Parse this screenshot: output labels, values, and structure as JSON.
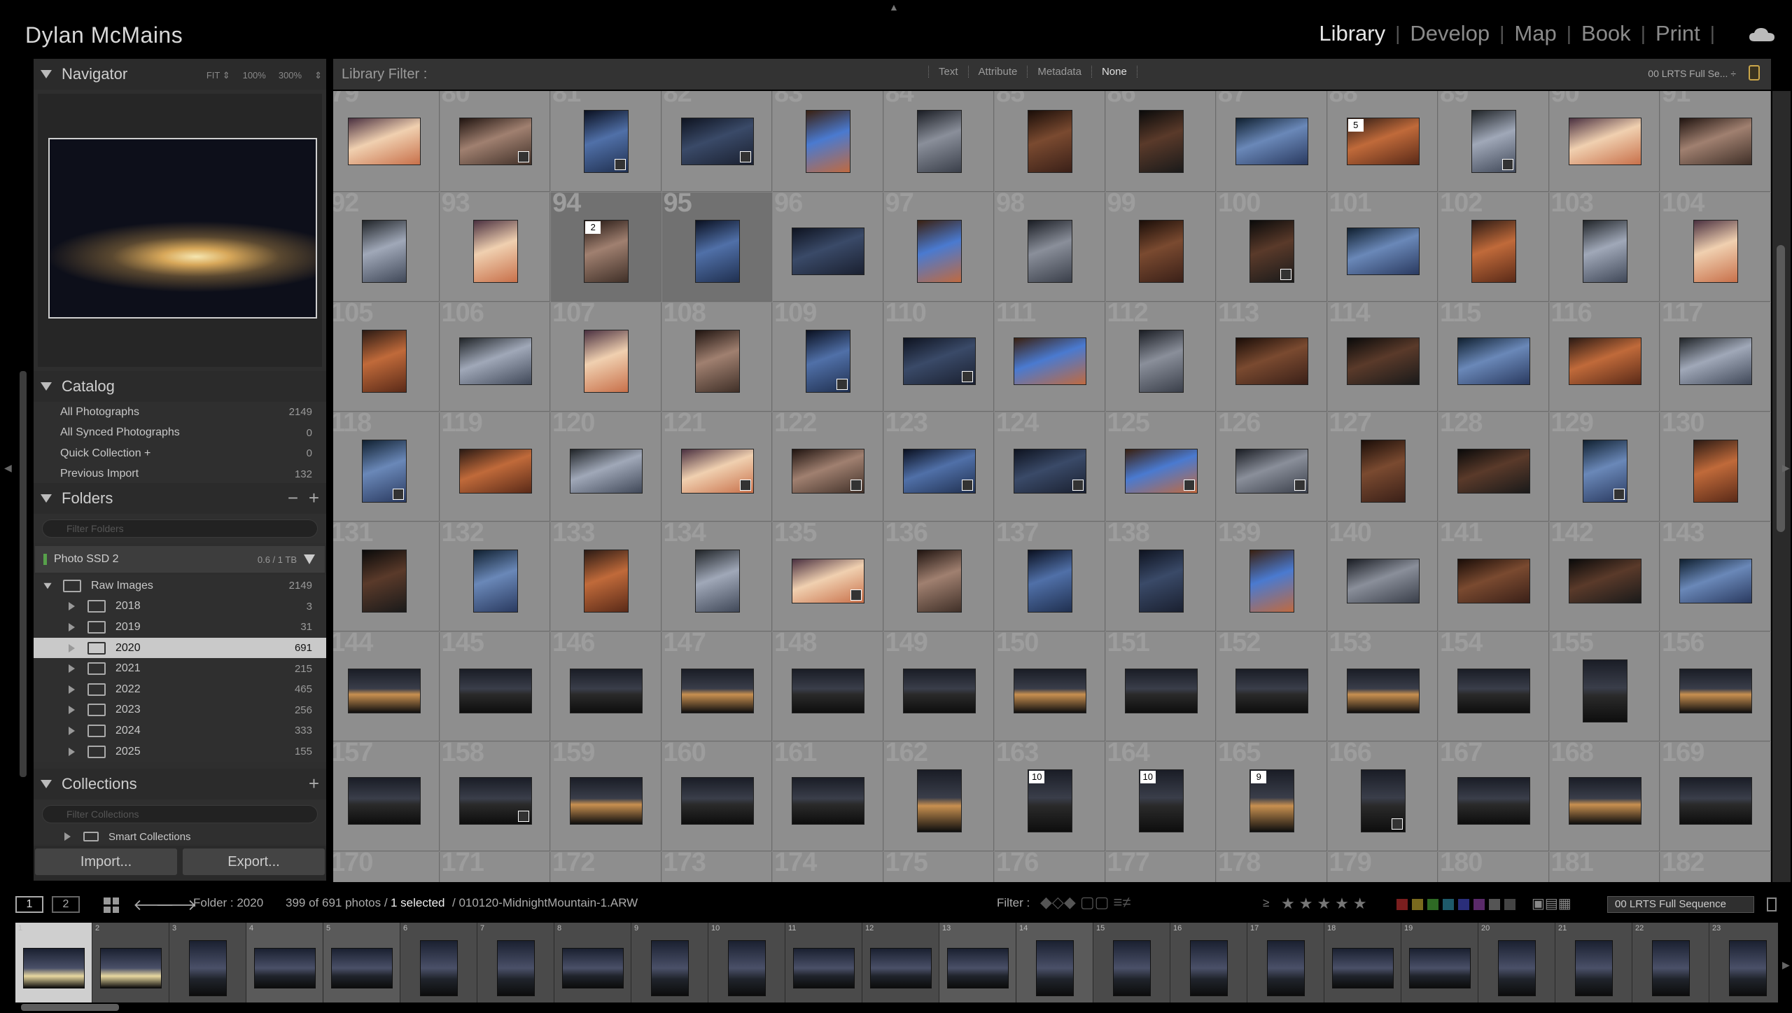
{
  "identity_plate": "Dylan McMains",
  "modules": [
    "Library",
    "Develop",
    "Map",
    "Book",
    "Print"
  ],
  "active_module": "Library",
  "navigator": {
    "title": "Navigator",
    "zoom": [
      "FIT ⇕",
      "100%",
      "300%",
      "⇕"
    ]
  },
  "catalog": {
    "title": "Catalog",
    "items": [
      {
        "label": "All Photographs",
        "count": "2149"
      },
      {
        "label": "All Synced Photographs",
        "count": "0"
      },
      {
        "label": "Quick Collection +",
        "count": "0"
      },
      {
        "label": "Previous Import",
        "count": "132"
      }
    ]
  },
  "folders": {
    "title": "Folders",
    "filter_placeholder": "Filter Folders",
    "volume": "Photo SSD 2",
    "volume_cap": "0.6 / 1 TB",
    "root": {
      "label": "Raw Images",
      "count": "2149"
    },
    "items": [
      {
        "label": "2018",
        "count": "3"
      },
      {
        "label": "2019",
        "count": "31"
      },
      {
        "label": "2020",
        "count": "691"
      },
      {
        "label": "2021",
        "count": "215"
      },
      {
        "label": "2022",
        "count": "465"
      },
      {
        "label": "2023",
        "count": "256"
      },
      {
        "label": "2024",
        "count": "333"
      },
      {
        "label": "2025",
        "count": "155"
      }
    ]
  },
  "collections": {
    "title": "Collections",
    "filter_placeholder": "Filter Collections",
    "first_item": "Smart Collections"
  },
  "buttons": {
    "import": "Import...",
    "export": "Export..."
  },
  "library_filter": {
    "label": "Library Filter :",
    "options": [
      "Text",
      "Attribute",
      "Metadata",
      "None"
    ],
    "active": "None",
    "preset": "00 LRTS Full Se... ÷"
  },
  "grid": {
    "start": 79,
    "cols": 13,
    "rows": 8,
    "stacks": {
      "88": "5",
      "94": "2",
      "163": "10",
      "164": "10",
      "165": "9"
    }
  },
  "filmbar": {
    "view1": "1",
    "view2": "2",
    "folder": "Folder : 2020",
    "count_text": "399 of 691 photos /",
    "selected": "1 selected",
    "path": "/ 010120-MidnightMountain-1.ARW",
    "filter_label": "Filter :",
    "sequence": "00 LRTS Full Sequence"
  },
  "swatch_colors": [
    "#7a1e1e",
    "#7a6a1e",
    "#2e6a24",
    "#1e5a6a",
    "#2a2e7a",
    "#5a2a6a",
    "#555555",
    "#444444"
  ]
}
